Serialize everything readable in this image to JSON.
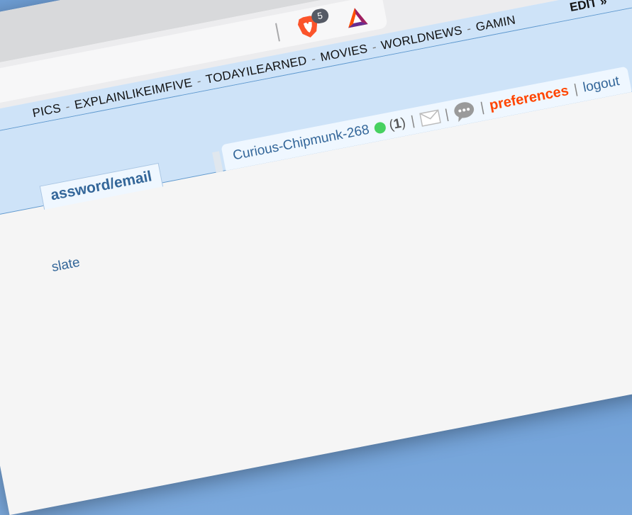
{
  "browser": {
    "shields_count": "5"
  },
  "subreddits": {
    "items": [
      "PICS",
      "EXPLAINLIKEIMFIVE",
      "TODAYILEARNED",
      "MOVIES",
      "WORLDNEWS",
      "GAMIN"
    ],
    "separator": "-",
    "edit_label": "EDIT »"
  },
  "tab": {
    "label": "assword/email"
  },
  "user": {
    "username": "Curious-Chipmunk-268",
    "karma_open": "(",
    "karma": "1",
    "karma_close": ")",
    "pipe": "|",
    "preferences_label": "preferences",
    "logout_label": "logout",
    "online_color": "#46d160"
  },
  "content": {
    "link_text": "slate"
  },
  "icons": {
    "menu": "hamburger-menu-icon",
    "brave": "brave-lion-icon",
    "bat": "bat-triangle-icon",
    "mail": "envelope-icon",
    "chat": "chat-bubble-icon"
  }
}
